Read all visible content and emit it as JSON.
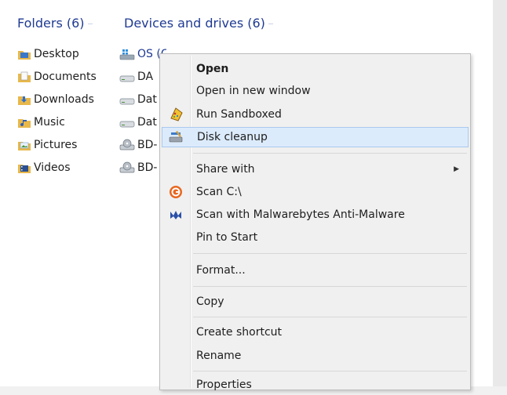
{
  "folders_group": {
    "title": "Folders (6)",
    "items": [
      "Desktop",
      "Documents",
      "Downloads",
      "Music",
      "Pictures",
      "Videos"
    ]
  },
  "devices_group": {
    "title": "Devices and drives (6)",
    "items": [
      "OS (C:)",
      "DA",
      "Dat",
      "Dat",
      "BD-",
      "BD-"
    ]
  },
  "context_menu": {
    "open": "Open",
    "open_new_window": "Open in new window",
    "run_sandboxed": "Run Sandboxed",
    "disk_cleanup": "Disk cleanup",
    "share_with": "Share with",
    "scan_c": "Scan C:\\",
    "scan_malwarebytes": "Scan with Malwarebytes Anti-Malware",
    "pin_to_start": "Pin to Start",
    "format": "Format...",
    "copy": "Copy",
    "create_shortcut": "Create shortcut",
    "rename": "Rename",
    "properties": "Properties"
  },
  "colors": {
    "header_blue": "#1f3a93",
    "hover_fill": "#dcebfb",
    "hover_border": "#a9c8ee"
  }
}
